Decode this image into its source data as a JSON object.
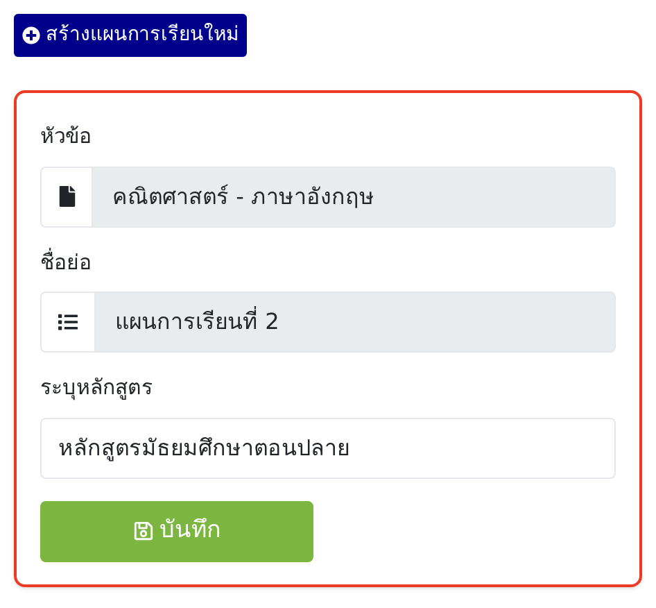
{
  "create_button": {
    "label": "สร้างแผนการเรียนใหม่"
  },
  "form": {
    "fields": [
      {
        "kind": "document",
        "label": "หัวข้อ",
        "value": "คณิตศาสตร์ - ภาษาอังกฤษ",
        "disabled": true
      },
      {
        "kind": "list",
        "label": "ชื่อย่อ",
        "value": "แผนการเรียนที่ 2",
        "disabled": true
      },
      {
        "kind": "plain",
        "label": "ระบุหลักสูตร",
        "value": "หลักสูตรมัธยมศึกษาตอนปลาย",
        "disabled": false
      }
    ],
    "save_button": {
      "label": "บันทึก"
    }
  }
}
